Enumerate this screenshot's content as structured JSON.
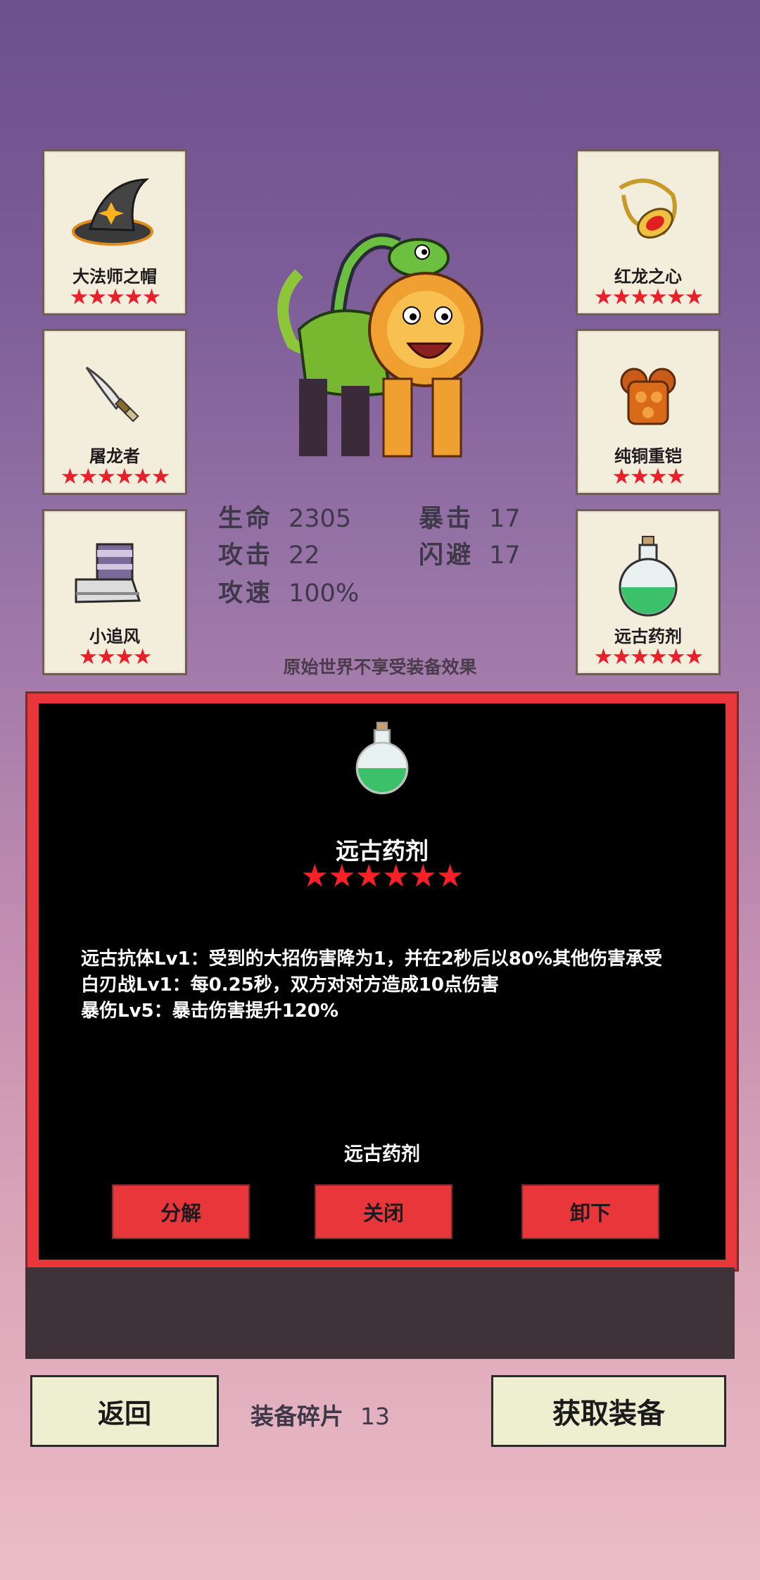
{
  "equipment_left": [
    {
      "name": "大法师之帽",
      "stars": "★★★★★",
      "icon": "wizard-hat-icon"
    },
    {
      "name": "屠龙者",
      "stars": "★★★★★★",
      "icon": "dagger-icon"
    },
    {
      "name": "小追风",
      "stars": "★★★★",
      "icon": "boot-icon"
    }
  ],
  "equipment_right": [
    {
      "name": "红龙之心",
      "stars": "★★★★★★",
      "icon": "amulet-icon"
    },
    {
      "name": "纯铜重铠",
      "stars": "★★★★",
      "icon": "armor-icon"
    },
    {
      "name": "远古药剂",
      "stars": "★★★★★★",
      "icon": "potion-icon"
    }
  ],
  "stats": {
    "hp_label": "生命",
    "hp": "2305",
    "atk_label": "攻击",
    "atk": "22",
    "speed_label": "攻速",
    "speed": "100%",
    "crit_label": "暴击",
    "crit": "17",
    "dodge_label": "闪避",
    "dodge": "17"
  },
  "notice": "原始世界不享受装备效果",
  "detail": {
    "title": "远古药剂",
    "stars": "★★★★★★",
    "desc": [
      "远古抗体Lv1：受到的大招伤害降为1，并在2秒后以80%其他伤害承受",
      "白刃战Lv1：每0.25秒，双方对对方造成10点伤害",
      "暴伤Lv5：暴击伤害提升120%"
    ],
    "subtitle": "远古药剂",
    "btn_decompose": "分解",
    "btn_close": "关闭",
    "btn_unequip": "卸下"
  },
  "footer": {
    "back": "返回",
    "fragments_label": "装备碎片",
    "fragments_count": "13",
    "get_equipment": "获取装备"
  },
  "colors": {
    "star": "#e8202a",
    "panel": "#e8363a",
    "card": "#f3eedc"
  }
}
